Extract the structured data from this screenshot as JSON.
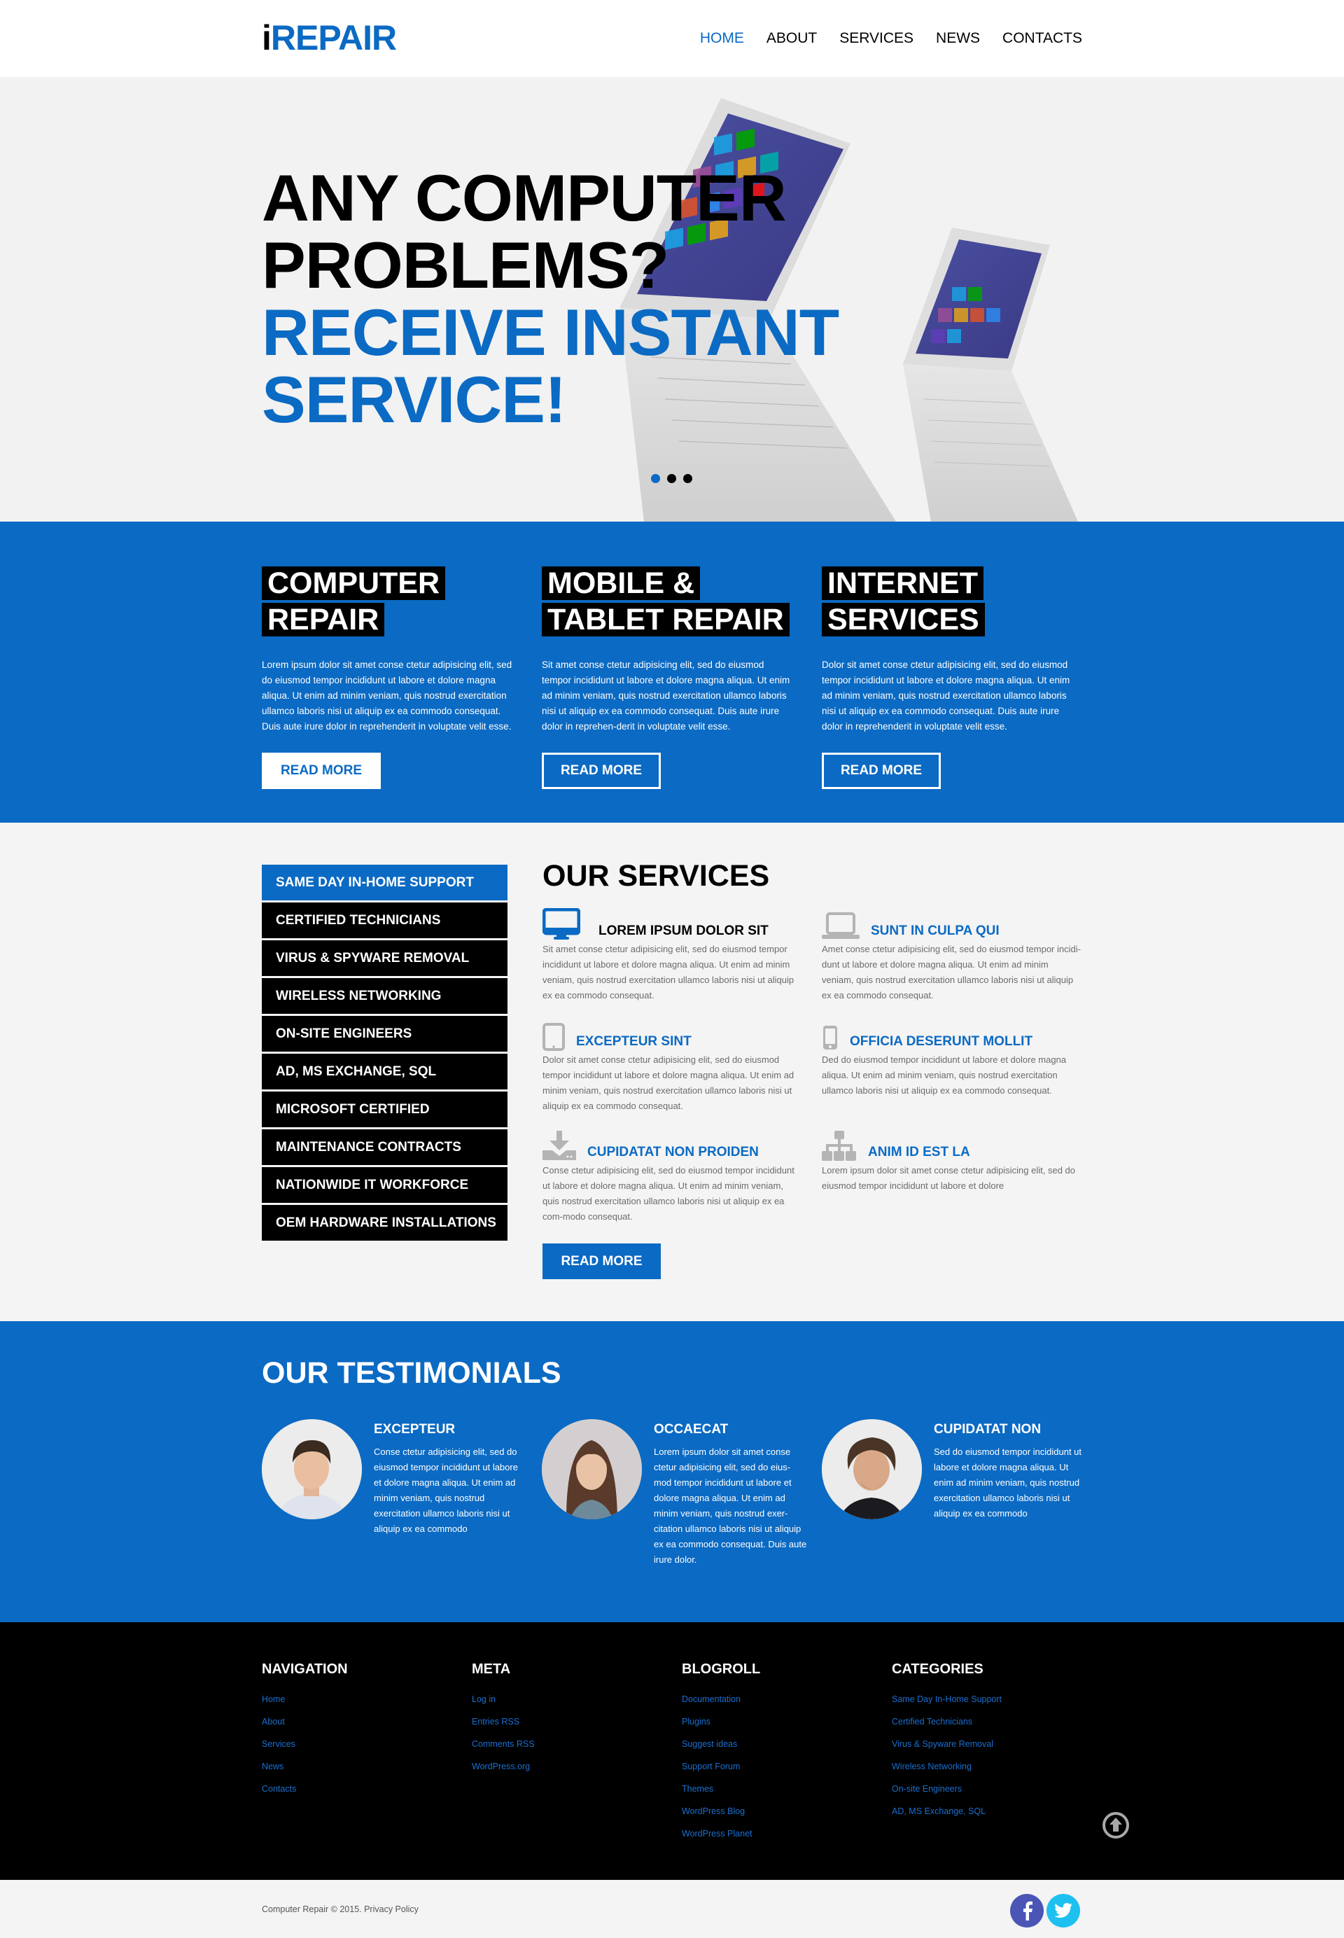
{
  "header": {
    "logo_prefix": "i",
    "logo_rest": "REPAIR",
    "nav": [
      {
        "label": "HOME",
        "active": true
      },
      {
        "label": "ABOUT",
        "active": false
      },
      {
        "label": "SERVICES",
        "active": false
      },
      {
        "label": "NEWS",
        "active": false
      },
      {
        "label": "CONTACTS",
        "active": false
      }
    ]
  },
  "hero": {
    "line1": "ANY COMPUTER",
    "line2": "PROBLEMS?",
    "line3": "RECEIVE INSTANT",
    "line4": "SERVICE!",
    "image_alt": "two-laptops-image",
    "slider": {
      "count": 3,
      "active": 1
    }
  },
  "features": [
    {
      "title_line1": "COMPUTER",
      "title_line2": "REPAIR",
      "text": "Lorem ipsum dolor sit amet conse ctetur adipisicing elit, sed do eiusmod tempor incididunt ut labore et dolore magna aliqua. Ut enim ad minim veniam, quis nostrud exercitation ullamco laboris nisi ut aliquip ex ea commodo consequat. Duis aute irure dolor in reprehenderit in voluptate velit esse.",
      "button": "READ MORE"
    },
    {
      "title_line1": "MOBILE &",
      "title_line2": "TABLET REPAIR",
      "text": "Sit amet conse ctetur adipisicing elit, sed do eiusmod tempor incididunt ut labore et dolore magna aliqua. Ut enim ad minim veniam, quis nostrud exercitation ullamco laboris nisi ut aliquip ex ea commodo consequat. Duis aute irure dolor in reprehen-derit in voluptate velit esse.",
      "button": "READ MORE"
    },
    {
      "title_line1": "INTERNET",
      "title_line2": "SERVICES",
      "text": "Dolor sit amet conse ctetur adipisicing elit, sed do eiusmod tempor incididunt ut labore et dolore magna aliqua. Ut enim ad minim veniam, quis nostrud exercitation ullamco laboris nisi ut aliquip ex ea commodo consequat. Duis aute irure dolor in reprehenderit in voluptate velit esse.",
      "button": "READ MORE"
    }
  ],
  "side_menu": [
    {
      "label": "SAME DAY IN-HOME SUPPORT",
      "active": true
    },
    {
      "label": "CERTIFIED TECHNICIANS"
    },
    {
      "label": "VIRUS & SPYWARE REMOVAL"
    },
    {
      "label": "WIRELESS NETWORKING"
    },
    {
      "label": "ON-SITE ENGINEERS"
    },
    {
      "label": "AD, MS EXCHANGE, SQL"
    },
    {
      "label": "MICROSOFT CERTIFIED"
    },
    {
      "label": "MAINTENANCE CONTRACTS"
    },
    {
      "label": "NATIONWIDE IT WORKFORCE"
    },
    {
      "label": "OEM HARDWARE INSTALLATIONS"
    }
  ],
  "services": {
    "title": "OUR SERVICES",
    "items": [
      {
        "icon": "monitor-icon",
        "name": "LOREM IPSUM DOLOR SIT",
        "text": "Sit amet conse ctetur adipisicing elit, sed do eiusmod tempor incididunt ut labore et dolore magna aliqua. Ut enim ad minim veniam, quis nostrud exercitation ullamco laboris nisi ut aliquip ex ea commodo consequat."
      },
      {
        "icon": "laptop-icon",
        "name": "SUNT IN CULPA QUI",
        "text": "Amet conse ctetur adipisicing elit, sed do eiusmod tempor incidi-dunt ut labore et dolore magna aliqua. Ut enim ad minim veniam, quis nostrud exercitation ullamco laboris nisi ut aliquip ex ea commodo consequat."
      },
      {
        "icon": "tablet-icon",
        "name": "EXCEPTEUR SINT",
        "text": "Dolor sit amet conse ctetur adipisicing elit, sed do eiusmod tempor incididunt ut labore et dolore magna aliqua. Ut enim ad minim veniam, quis nostrud exercitation ullamco laboris nisi ut aliquip ex ea commodo consequat."
      },
      {
        "icon": "phone-icon",
        "name": "OFFICIA DESERUNT MOLLIT",
        "text": "Ded do eiusmod tempor incididunt ut labore et dolore magna aliqua. Ut enim ad minim veniam, quis nostrud exercitation ullamco laboris nisi ut aliquip ex ea commodo consequat."
      },
      {
        "icon": "download-icon",
        "name": "CUPIDATAT NON PROIDEN",
        "text": "Conse ctetur adipisicing elit, sed do eiusmod tempor incididunt ut labore et dolore magna aliqua. Ut enim ad minim veniam, quis nostrud exercitation ullamco laboris nisi ut aliquip ex ea com-modo consequat."
      },
      {
        "icon": "sitemap-icon",
        "name": "ANIM ID EST LA",
        "text": "Lorem ipsum dolor sit amet conse ctetur adipisicing elit, sed do eiusmod tempor incididunt ut labore et dolore"
      }
    ],
    "button": "READ MORE"
  },
  "testimonials": {
    "title": "OUR TESTIMONIALS",
    "items": [
      {
        "name": "EXCEPTEUR",
        "text": "Conse ctetur adipisicing elit, sed do eiusmod tempor incididunt ut labore et dolore magna aliqua. Ut enim ad minim veniam, quis nostrud exercitation ullamco laboris nisi ut aliquip ex ea commodo"
      },
      {
        "name": "OCCAECAT",
        "text": "Lorem ipsum dolor sit amet conse ctetur adipisicing elit, sed do eius-mod tempor incididunt ut labore et dolore magna aliqua. Ut enim ad minim veniam, quis nostrud exer-citation ullamco laboris nisi ut aliquip ex ea commodo consequat. Duis aute irure dolor."
      },
      {
        "name": "CUPIDATAT NON",
        "text": "Sed do eiusmod tempor incididunt ut labore et dolore magna aliqua. Ut enim ad minim veniam, quis nostrud exercitation ullamco laboris nisi ut aliquip ex ea commodo"
      }
    ]
  },
  "footer": {
    "columns": [
      {
        "title": "NAVIGATION",
        "links": [
          "Home",
          "About",
          "Services",
          "News",
          "Contacts"
        ]
      },
      {
        "title": "META",
        "links": [
          "Log in",
          "Entries RSS",
          "Comments RSS",
          "WordPress.org"
        ]
      },
      {
        "title": "BLOGROLL",
        "links": [
          "Documentation",
          "Plugins",
          "Suggest ideas",
          "Support Forum",
          "Themes",
          "WordPress Blog",
          "WordPress Planet"
        ]
      },
      {
        "title": "CATEGORIES",
        "links": [
          "Same Day In-Home Support",
          "Certified Technicians",
          "Virus & Spyware Removal",
          "Wireless Networking",
          "On-site Engineers",
          "AD, MS Exchange, SQL"
        ]
      }
    ],
    "copyright": "Computer Repair © 2015. Privacy Policy",
    "social": [
      {
        "name": "facebook",
        "glyph": "f",
        "color": "#4b55b5"
      },
      {
        "name": "twitter",
        "glyph": "t",
        "color": "#1ec0f0"
      }
    ]
  },
  "colors": {
    "accent": "#0b6ac3",
    "dark": "#000000",
    "light_bg": "#f4f4f4"
  }
}
